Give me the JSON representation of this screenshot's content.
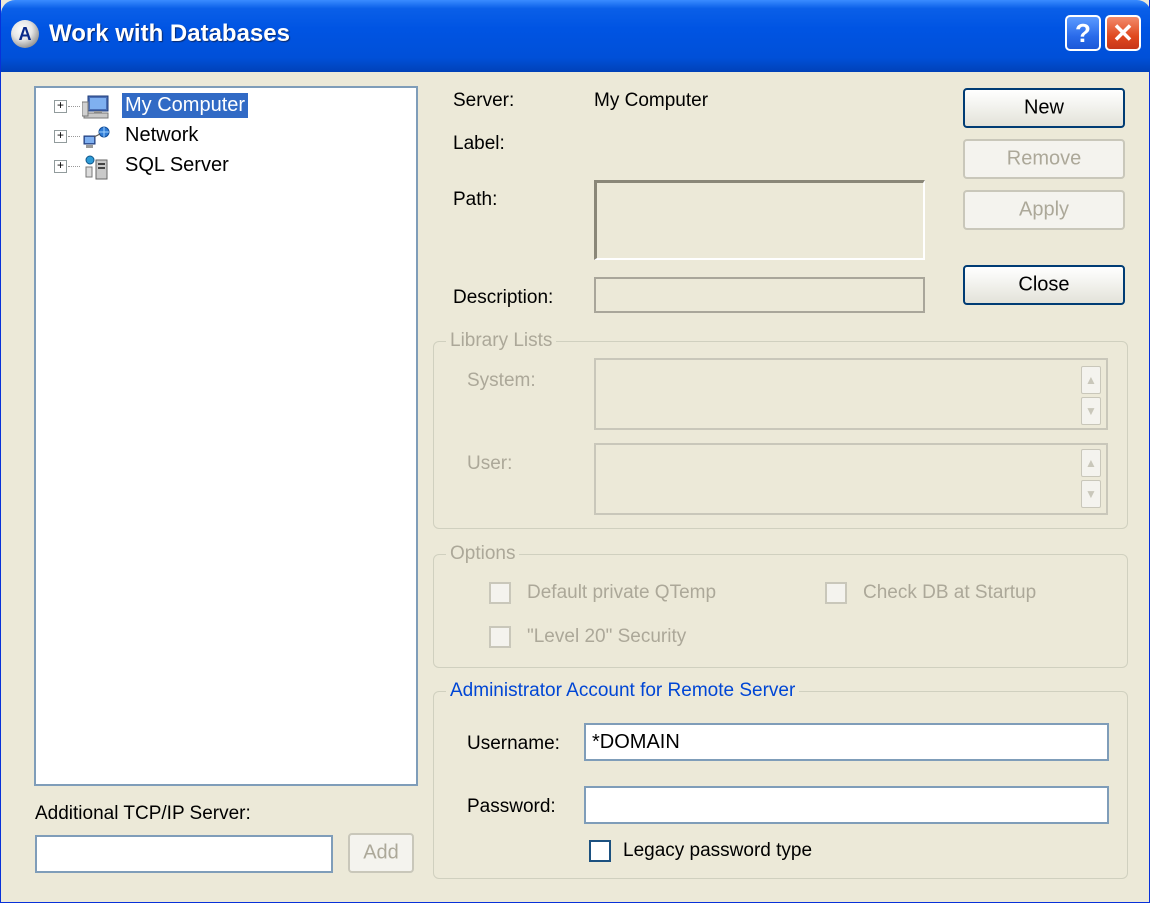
{
  "window": {
    "title": "Work with Databases",
    "app_icon": "A",
    "help_glyph": "?",
    "close_glyph": "✕"
  },
  "tree": {
    "items": [
      {
        "label": "My Computer",
        "icon": "computer-icon",
        "selected": true
      },
      {
        "label": "Network",
        "icon": "network-icon",
        "selected": false
      },
      {
        "label": "SQL Server",
        "icon": "sql-server-icon",
        "selected": false
      }
    ]
  },
  "tcp": {
    "label": "Additional TCP/IP Server:",
    "input_value": "",
    "add_label": "Add"
  },
  "details": {
    "server_label": "Server:",
    "server_value": "My Computer",
    "label_label": "Label:",
    "path_label": "Path:",
    "description_label": "Description:"
  },
  "buttons": {
    "new": "New",
    "remove": "Remove",
    "apply": "Apply",
    "close": "Close"
  },
  "library_lists": {
    "title": "Library Lists",
    "system_label": "System:",
    "user_label": "User:"
  },
  "options": {
    "title": "Options",
    "default_private_qtemp": "Default private QTemp",
    "check_db_at_startup": "Check DB at Startup",
    "level20_security": "\"Level 20\" Security"
  },
  "admin": {
    "title": "Administrator Account for Remote Server",
    "username_label": "Username:",
    "username_value": "*DOMAIN",
    "password_label": "Password:",
    "password_value": "",
    "legacy_label": "Legacy password type"
  },
  "colors": {
    "titlebar": "#0054E3",
    "selection": "#316AC5",
    "dialog_bg": "#ECE9D8",
    "group_title_blue": "#0046D5",
    "disabled_text": "#ACA899"
  }
}
